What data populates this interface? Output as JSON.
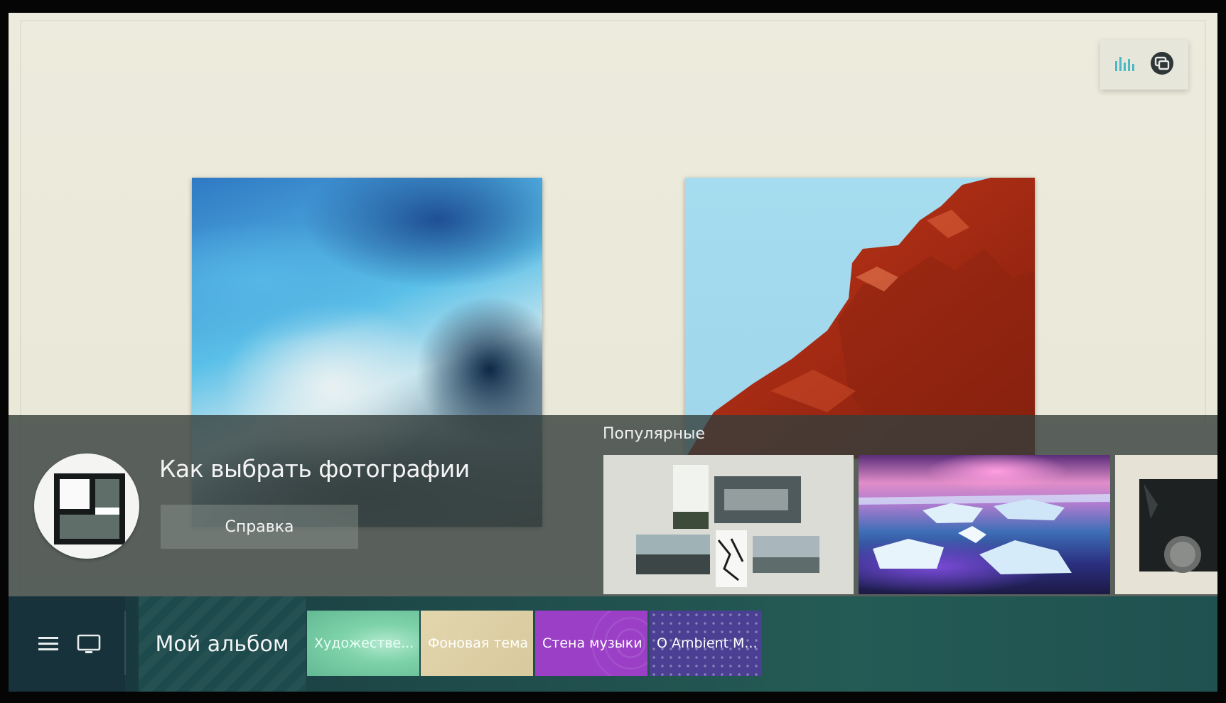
{
  "help": {
    "title": "Как выбрать фотографии",
    "button_label": "Справка"
  },
  "popular": {
    "label": "Популярные"
  },
  "bottom_bar": {
    "album_label": "Мой альбом",
    "categories": [
      {
        "label": "Художестве..."
      },
      {
        "label": "Фоновая тема"
      },
      {
        "label": "Стена музыки"
      },
      {
        "label": "О Ambient M..."
      }
    ]
  },
  "icons": {
    "top_widget": [
      "equalizer-icon",
      "screen-mirror-icon"
    ],
    "nav": [
      "menu-icon",
      "tv-icon"
    ]
  },
  "colors": {
    "wall": "#ebe9d9",
    "panel": "#343e3c",
    "bar": "#1f4a4a",
    "cat_art": "#7fd3aa",
    "cat_bg": "#d8c99e",
    "cat_music": "#9a3fc6",
    "cat_ambient": "#4a3f92"
  }
}
